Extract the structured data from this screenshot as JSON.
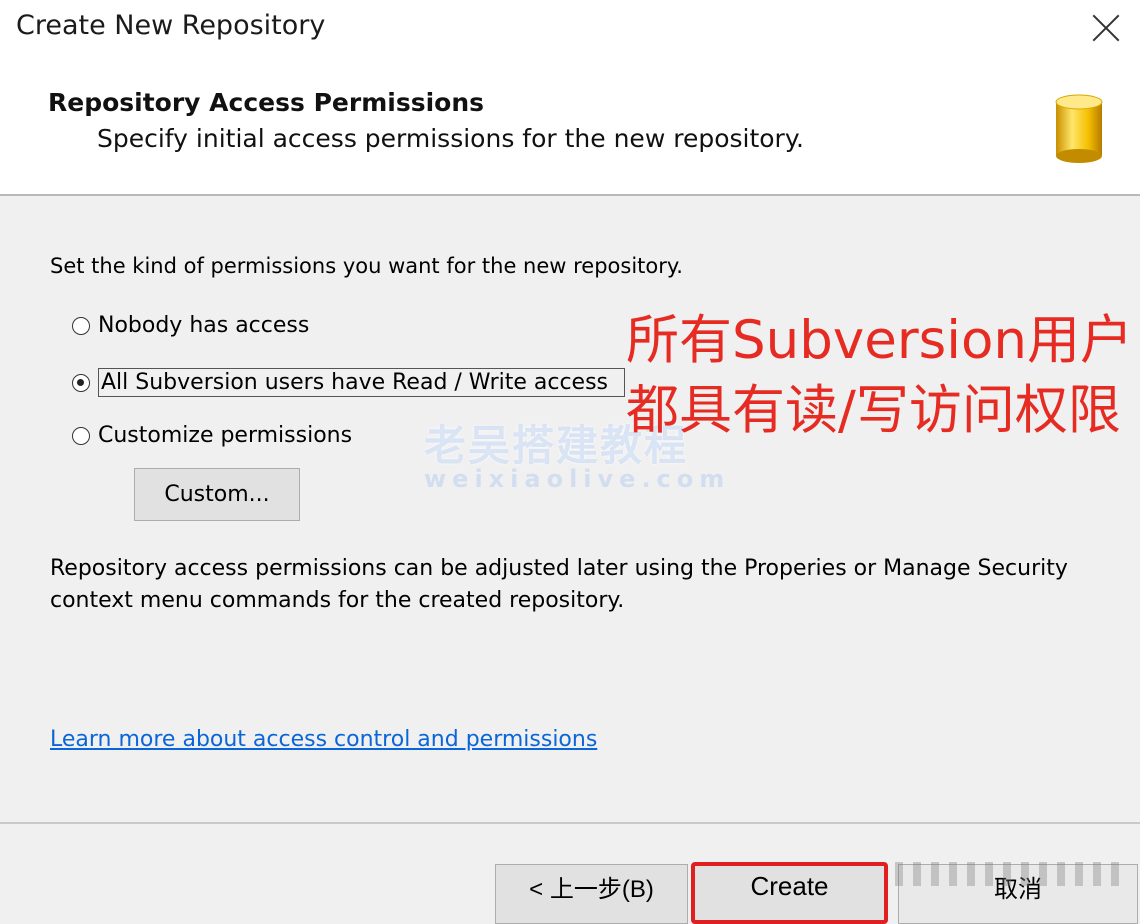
{
  "window": {
    "title": "Create New Repository"
  },
  "header": {
    "title": "Repository Access Permissions",
    "subtitle": "Specify initial access permissions for the new repository."
  },
  "body": {
    "intro": "Set the kind of permissions you want for the new repository.",
    "options": [
      {
        "label": "Nobody has access",
        "selected": false
      },
      {
        "label": "All Subversion users have Read / Write access",
        "selected": true
      },
      {
        "label": "Customize permissions",
        "selected": false
      }
    ],
    "custom_button": "Custom...",
    "note": "Repository access permissions can be adjusted later using the Properies or Manage Security context menu commands for the created repository.",
    "link": "Learn more about access control and permissions"
  },
  "annotation": {
    "text": "所有Subversion用户都具有读/写访问权限",
    "color": "#e62b23"
  },
  "watermark": {
    "cn": "老吴搭建教程",
    "en": "weixiaolive.com"
  },
  "footer": {
    "back": "< 上一步(B)",
    "create": "Create",
    "cancel": "取消",
    "highlight_color": "#e02020"
  },
  "icons": [
    "close-icon",
    "database-icon"
  ]
}
